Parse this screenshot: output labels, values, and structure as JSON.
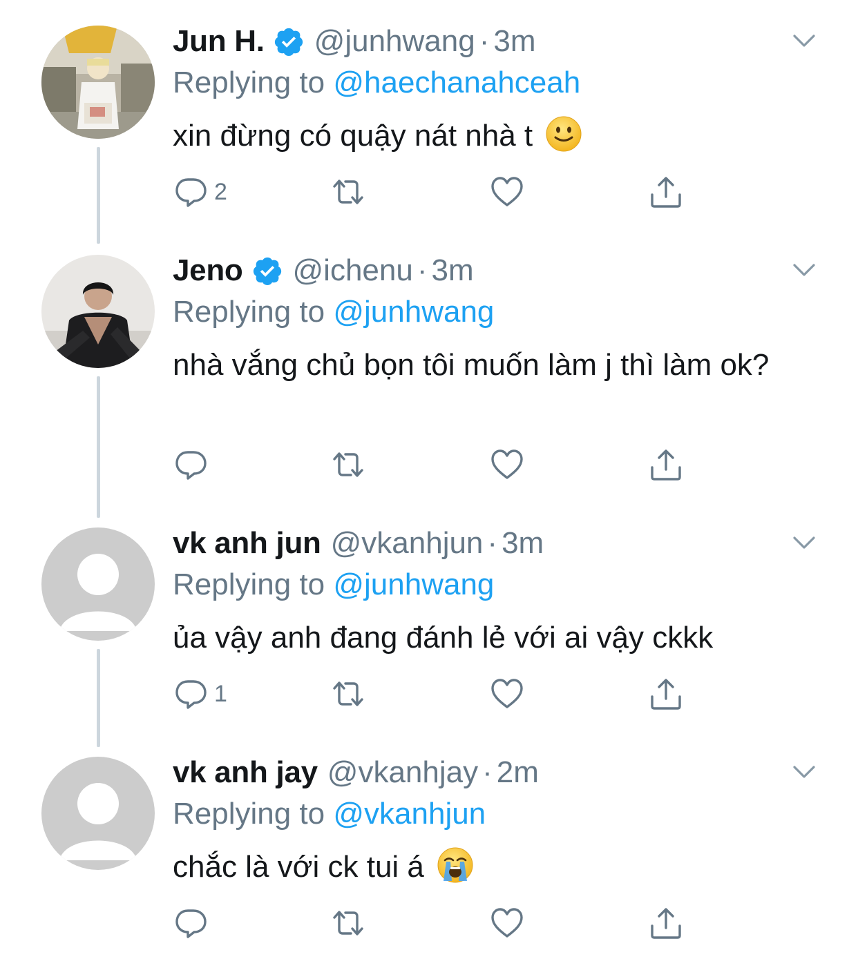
{
  "tweets": [
    {
      "name": "Jun H.",
      "verified": true,
      "handle": "@junhwang",
      "dot": "·",
      "time": "3m",
      "replying_prefix": "Replying to ",
      "replying_to": "@haechanahceah",
      "text": "xin đừng có quậy nát nhà t",
      "emoji": "slightly-smiling-face",
      "reply_count": "2",
      "avatar": "photo-person-outdoors"
    },
    {
      "name": "Jeno",
      "verified": true,
      "handle": "@ichenu",
      "dot": "·",
      "time": "3m",
      "replying_prefix": "Replying to ",
      "replying_to": "@junhwang",
      "text": "nhà vắng chủ bọn tôi muốn làm j thì làm ok?",
      "emoji": "",
      "reply_count": "",
      "avatar": "photo-person-black-suit"
    },
    {
      "name": "vk anh jun",
      "verified": false,
      "handle": "@vkanhjun",
      "dot": "·",
      "time": "3m",
      "replying_prefix": "Replying to ",
      "replying_to": "@junhwang",
      "text": "ủa vậy anh đang đánh lẻ với ai vậy ckkk",
      "emoji": "",
      "reply_count": "1",
      "avatar": "default-avatar"
    },
    {
      "name": "vk anh jay",
      "verified": false,
      "handle": "@vkanhjay",
      "dot": "·",
      "time": "2m",
      "replying_prefix": "Replying to ",
      "replying_to": "@vkanhjun",
      "text": "chắc là với ck tui á",
      "emoji": "loudly-crying-face",
      "reply_count": "",
      "avatar": "default-avatar"
    }
  ],
  "colors": {
    "text": "#14171a",
    "secondary": "#657786",
    "link": "#1da1f2",
    "thread_line": "#ccd6dd",
    "default_avatar_bg": "#cccccc"
  }
}
